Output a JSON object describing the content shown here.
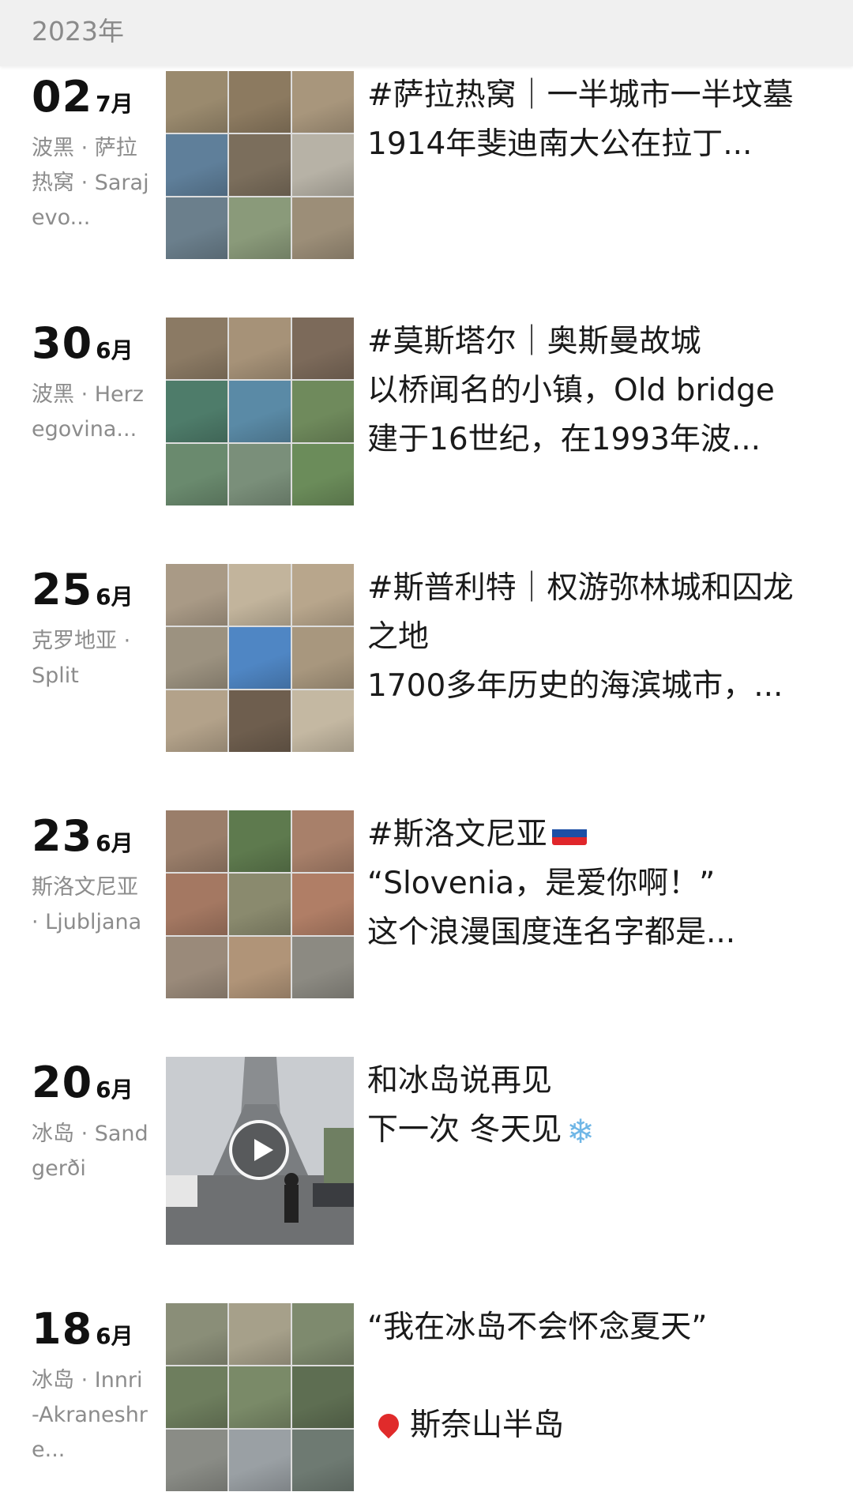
{
  "year": "2023年",
  "entries": [
    {
      "day": "02",
      "month": "7月",
      "location": "波黑 · 萨拉热窝 · Sarajevo...",
      "lines": [
        "#萨拉热窝｜一半城市一半坟墓",
        "1914年斐迪南大公在拉丁..."
      ],
      "wrap_first": true,
      "media": "grid",
      "tiles": [
        "#9a8a6e",
        "#8c7a60",
        "#a8967c",
        "#5f7f9a",
        "#7b6e5c",
        "#b7b2a6",
        "#6b7f8c",
        "#8a9a7a",
        "#9c8e78"
      ]
    },
    {
      "day": "30",
      "month": "6月",
      "location": "波黑 · Herzegovina...",
      "lines": [
        "#莫斯塔尔｜奥斯曼故城",
        "以桥闻名的小镇，Old bridge",
        "建于16世纪，在1993年波..."
      ],
      "media": "grid",
      "tiles": [
        "#8b7a64",
        "#a69278",
        "#7c6a5a",
        "#4e7c6a",
        "#5a8aa6",
        "#6f8a5c",
        "#6a8a6e",
        "#7a8f7a",
        "#6b8c5a"
      ]
    },
    {
      "day": "25",
      "month": "6月",
      "location": "克罗地亚 · Split",
      "lines": [
        "#斯普利特｜权游弥林城和囚龙之地",
        "1700多年历史的海滨城市，..."
      ],
      "wrap_first": true,
      "media": "grid",
      "tiles": [
        "#a99a86",
        "#c2b49c",
        "#b8a68c",
        "#9c9280",
        "#4f86c4",
        "#a8977e",
        "#b3a28a",
        "#6e5e4e",
        "#c4b8a2"
      ]
    },
    {
      "day": "23",
      "month": "6月",
      "location": "斯洛文尼亚 · Ljubljana",
      "lines": [
        "#斯洛文尼亚",
        "“Slovenia，是爱你啊！”",
        "这个浪漫国度连名字都是..."
      ],
      "flag": true,
      "media": "grid",
      "tiles": [
        "#9a7e6a",
        "#5e7a4e",
        "#a8806a",
        "#a47862",
        "#8a8a6e",
        "#b07e66",
        "#9a8a7a",
        "#b09478",
        "#8c8a82"
      ]
    },
    {
      "day": "20",
      "month": "6月",
      "location": "冰岛 · Sandgerði",
      "lines": [
        "和冰岛说再见",
        "下一次 冬天见"
      ],
      "snow": true,
      "media": "video"
    },
    {
      "day": "18",
      "month": "6月",
      "location": "冰岛 · Innri-Akraneshre...",
      "lines": [
        "“我在冰岛不会怀念夏天”",
        "",
        "斯奈山半岛"
      ],
      "pin_line": 2,
      "media": "grid",
      "tiles": [
        "#8a8e78",
        "#a6a08a",
        "#7e8a6e",
        "#6e7e5e",
        "#7a8a68",
        "#5e6e52",
        "#8a8c86",
        "#9aa0a4",
        "#6e7a72"
      ]
    }
  ]
}
